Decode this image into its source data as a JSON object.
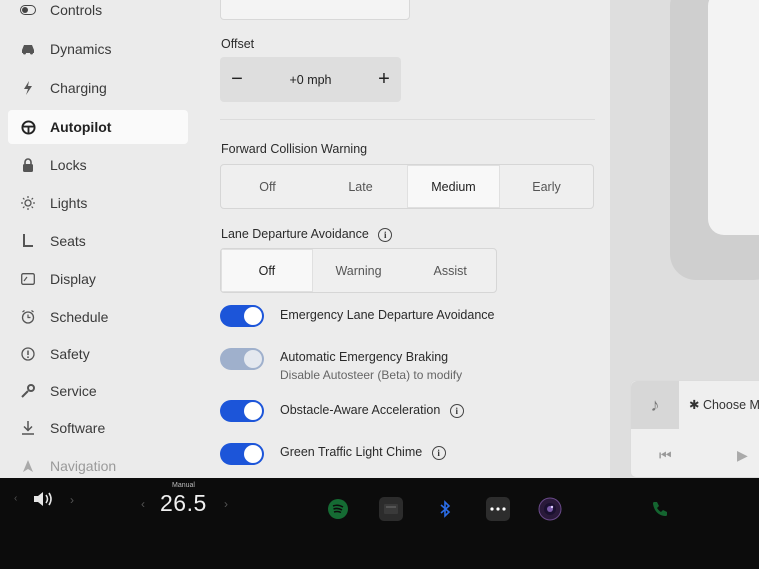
{
  "sidebar": {
    "items": [
      {
        "label": "Controls",
        "icon": "toggle-icon"
      },
      {
        "label": "Dynamics",
        "icon": "car-icon"
      },
      {
        "label": "Charging",
        "icon": "bolt-icon"
      },
      {
        "label": "Autopilot",
        "icon": "steering-wheel-icon"
      },
      {
        "label": "Locks",
        "icon": "lock-icon"
      },
      {
        "label": "Lights",
        "icon": "sun-icon"
      },
      {
        "label": "Seats",
        "icon": "seat-icon"
      },
      {
        "label": "Display",
        "icon": "display-icon"
      },
      {
        "label": "Schedule",
        "icon": "clock-icon"
      },
      {
        "label": "Safety",
        "icon": "alert-circle-icon"
      },
      {
        "label": "Service",
        "icon": "wrench-icon"
      },
      {
        "label": "Software",
        "icon": "download-icon"
      },
      {
        "label": "Navigation",
        "icon": "navigation-icon"
      }
    ],
    "active": "Autopilot"
  },
  "offset": {
    "label": "Offset",
    "minus": "−",
    "value": "+0 mph",
    "plus": "+"
  },
  "fcw": {
    "label": "Forward Collision Warning",
    "options": [
      "Off",
      "Late",
      "Medium",
      "Early"
    ],
    "selected": "Medium"
  },
  "lda": {
    "label": "Lane Departure Avoidance",
    "info": "i",
    "options": [
      "Off",
      "Warning",
      "Assist"
    ],
    "selected": "Off"
  },
  "toggles": [
    {
      "label": "Emergency Lane Departure Avoidance",
      "on": true
    },
    {
      "label": "Automatic Emergency Braking",
      "sub": "Disable Autosteer (Beta) to modify",
      "on": true,
      "disabled": true
    },
    {
      "label": "Obstacle-Aware Acceleration",
      "on": true,
      "info": "i"
    },
    {
      "label": "Green Traffic Light Chime",
      "on": true,
      "info": "i"
    }
  ],
  "media": {
    "choose": "✱ Choose M"
  },
  "taskbar": {
    "speed_caption": "Manual",
    "speed": "26.5"
  },
  "colors": {
    "accent": "#1c55d9",
    "spotify": "#1db954",
    "bluetooth": "#2b6de8",
    "phone": "#1aa24a"
  }
}
